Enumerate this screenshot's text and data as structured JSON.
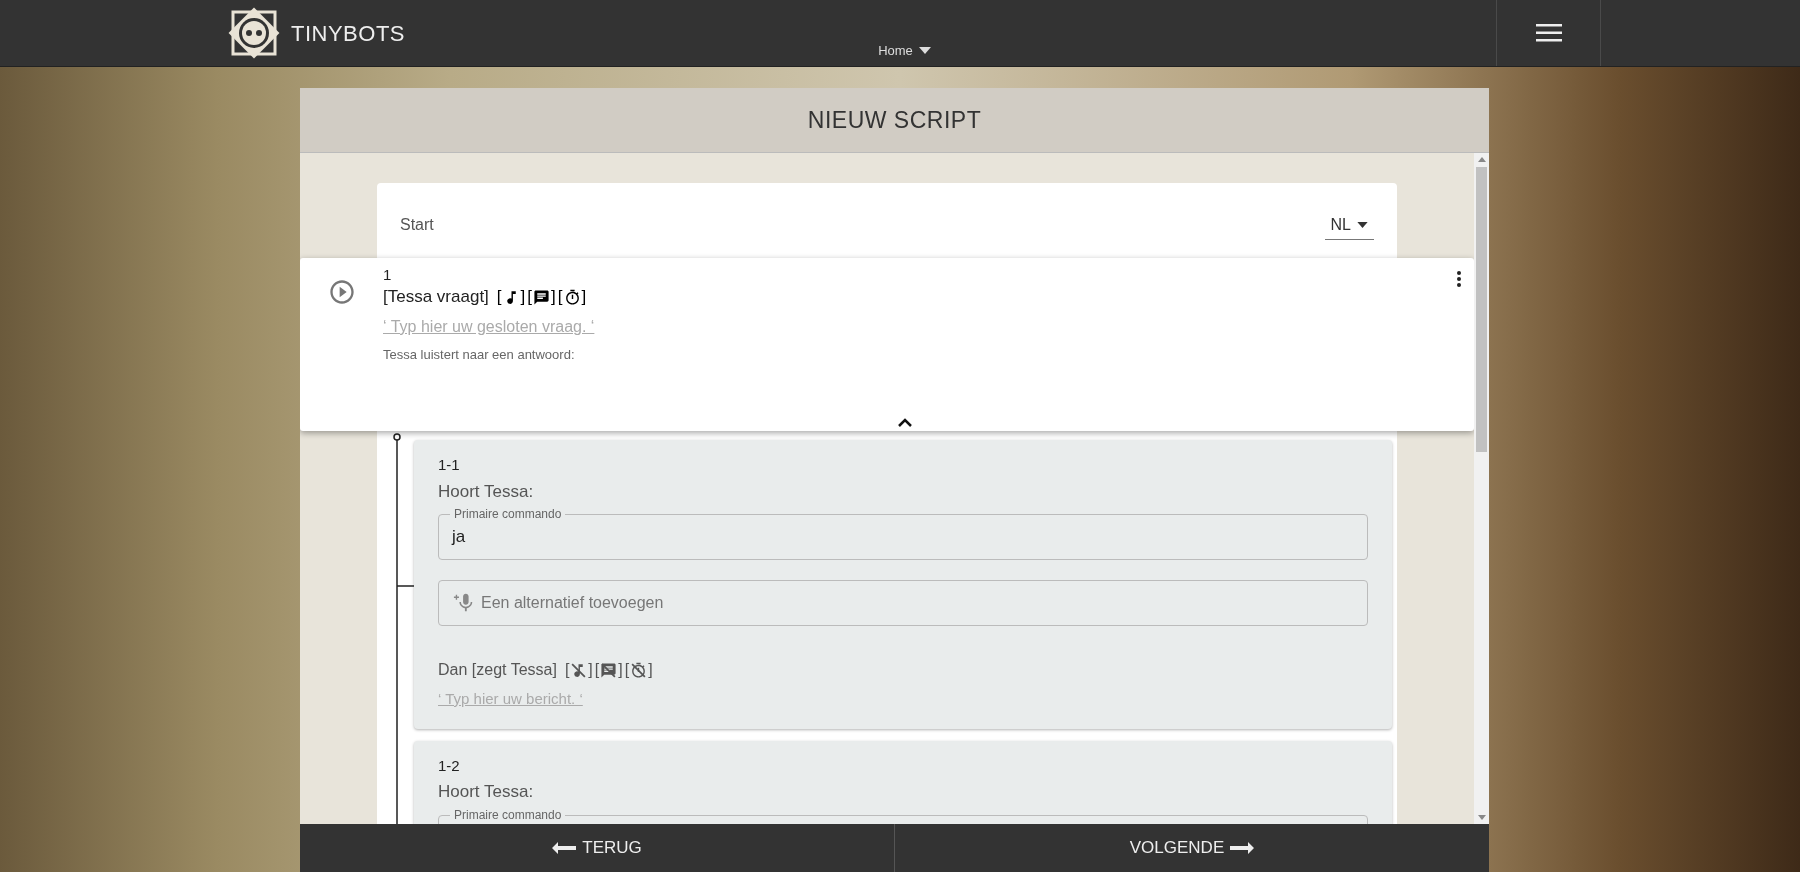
{
  "header": {
    "brand": "TINYBOTS",
    "nav_menu": "Home"
  },
  "panel": {
    "title": "NIEUW SCRIPT"
  },
  "script": {
    "start_label": "Start",
    "language": "NL"
  },
  "step": {
    "number": "1",
    "action": "[Tessa vraagt]",
    "brackets": [
      "[",
      "]"
    ],
    "media_toggles": [
      {
        "kind": "music",
        "enabled": true
      },
      {
        "kind": "text",
        "enabled": true
      },
      {
        "kind": "timer",
        "enabled": true
      }
    ],
    "question_placeholder": "‘ Typ hier uw gesloten vraag. ‘",
    "listen_label": "Tessa luistert naar een antwoord:",
    "expanded": true
  },
  "branches": [
    {
      "number": "1-1",
      "hear_label": "Hoort Tessa:",
      "primary_label": "Primaire commando",
      "primary_value": "ja",
      "alt_placeholder": "Een alternatief toevoegen",
      "then_text": "Dan [zegt Tessa]",
      "brackets": [
        "[",
        "]"
      ],
      "media_toggles": [
        {
          "kind": "music",
          "enabled": false
        },
        {
          "kind": "text",
          "enabled": false
        },
        {
          "kind": "timer",
          "enabled": false
        }
      ],
      "message_placeholder": "‘ Typ hier uw bericht. ‘"
    },
    {
      "number": "1-2",
      "hear_label": "Hoort Tessa:",
      "primary_label": "Primaire commando"
    }
  ],
  "footer": {
    "back": "TERUG",
    "next": "VOLGENDE"
  }
}
